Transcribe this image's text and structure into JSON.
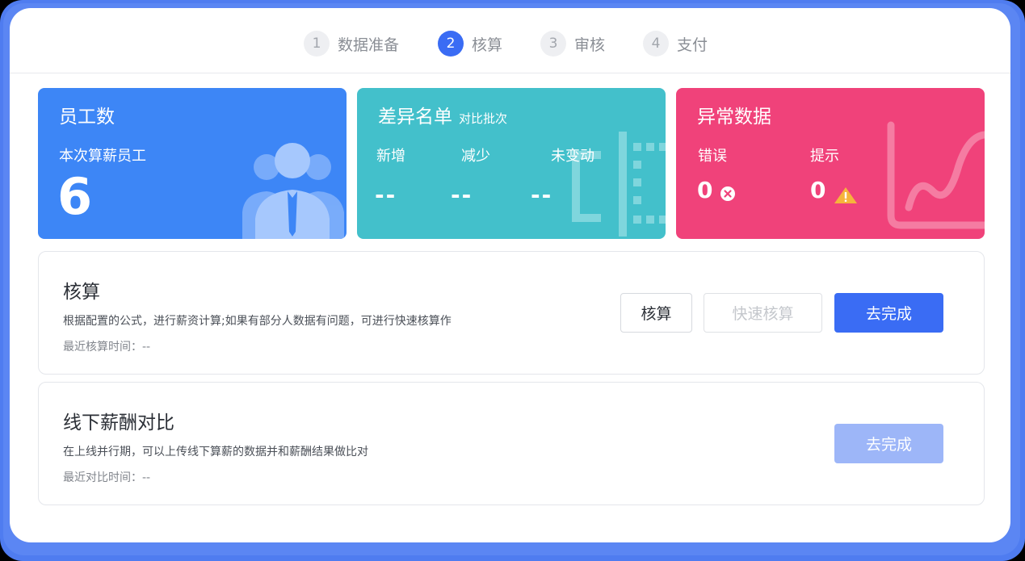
{
  "steps": [
    {
      "number": "1",
      "label": "数据准备",
      "active": false
    },
    {
      "number": "2",
      "label": "核算",
      "active": true
    },
    {
      "number": "3",
      "label": "审核",
      "active": false
    },
    {
      "number": "4",
      "label": "支付",
      "active": false
    }
  ],
  "cards": {
    "employees": {
      "title": "员工数",
      "subtitle": "本次算薪员工",
      "value": "6",
      "icon": "users-icon",
      "color": "#3d86f6"
    },
    "diff": {
      "title": "差异名单",
      "subtitle": "对比批次",
      "items": [
        {
          "label": "新增",
          "value": "--"
        },
        {
          "label": "减少",
          "value": "--"
        },
        {
          "label": "未变动",
          "value": "--"
        }
      ],
      "icon": "compare-icon",
      "color": "#43c0cb"
    },
    "anomaly": {
      "title": "异常数据",
      "items": [
        {
          "label": "错误",
          "value": "0",
          "icon": "error-icon"
        },
        {
          "label": "提示",
          "value": "0",
          "icon": "warning-icon"
        }
      ],
      "icon": "chart-line-icon",
      "color": "#f0427a"
    }
  },
  "sections": {
    "calc": {
      "title": "核算",
      "description": "根据配置的公式，进行薪资计算;如果有部分人数据有问题，可进行快速核算作",
      "time_label": "最近核算时间：--",
      "buttons": {
        "calc": "核算",
        "quick_calc": "快速核算",
        "complete": "去完成"
      }
    },
    "offline": {
      "title": "线下薪酬对比",
      "description": "在上线并行期，可以上传线下算薪的数据并和薪酬结果做比对",
      "time_label": "最近对比时间：--",
      "buttons": {
        "complete": "去完成"
      }
    }
  }
}
